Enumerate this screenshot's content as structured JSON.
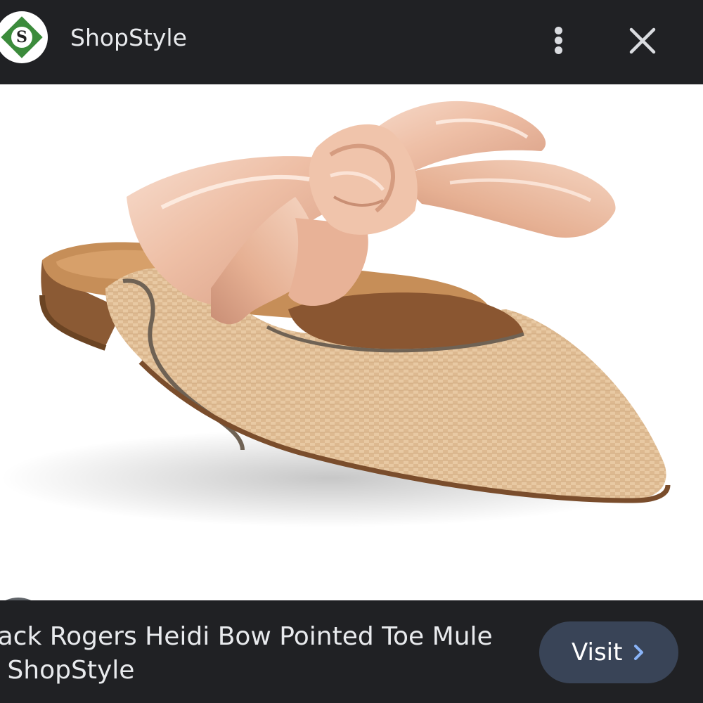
{
  "header": {
    "logo_letter": "S",
    "site_name": "ShopStyle",
    "more_icon": "more-vert-icon",
    "close_icon": "close-icon"
  },
  "image": {
    "subject": "shoe-product-image",
    "lens_icon": "google-lens-icon"
  },
  "footer": {
    "title_line1": "Jack Rogers Heidi Bow Pointed Toe Mule",
    "title_line2": "- ShopStyle",
    "visit_label": "Visit",
    "visit_icon": "chevron-right-icon"
  },
  "colors": {
    "background": "#202124",
    "visit_button": "#394457",
    "logo_green": "#3b8b3b"
  }
}
